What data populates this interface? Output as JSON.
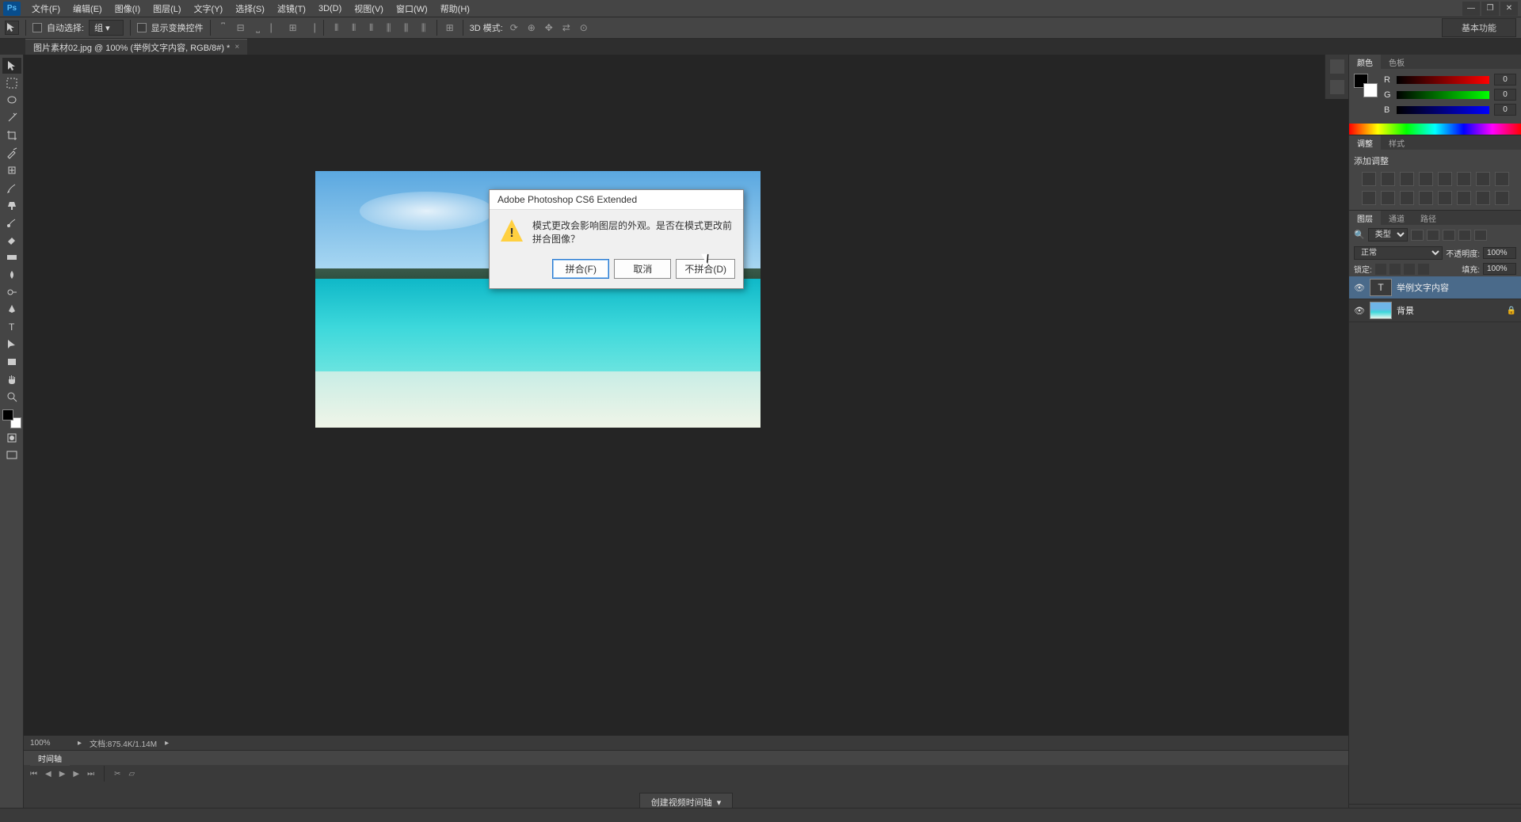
{
  "app": {
    "logo": "Ps"
  },
  "menubar": {
    "items": [
      "文件(F)",
      "编辑(E)",
      "图像(I)",
      "图层(L)",
      "文字(Y)",
      "选择(S)",
      "滤镜(T)",
      "3D(D)",
      "视图(V)",
      "窗口(W)",
      "帮助(H)"
    ]
  },
  "optionsbar": {
    "auto_select_label": "自动选择:",
    "auto_select_value": "组",
    "show_transform_label": "显示变换控件",
    "mode_3d_label": "3D 模式:",
    "basic_func": "基本功能"
  },
  "doctab": {
    "title": "图片素材02.jpg @ 100% (举例文字内容, RGB/8#) *",
    "close": "×"
  },
  "dialog": {
    "title": "Adobe Photoshop CS6 Extended",
    "message": "模式更改会影响图层的外观。是否在模式更改前拼合图像？",
    "icon_glyph": "!",
    "btn_flatten": "拼合(F)",
    "btn_cancel": "取消",
    "btn_dont_flatten": "不拼合(D)"
  },
  "statusbar": {
    "zoom": "100%",
    "doc_info": "文档:875.4K/1.14M"
  },
  "timeline": {
    "tab": "时间轴",
    "create_btn": "创建视频时间轴"
  },
  "panels": {
    "color": {
      "tab_color": "颜色",
      "tab_swatches": "色板",
      "r_label": "R",
      "r_val": "0",
      "g_label": "G",
      "g_val": "0",
      "b_label": "B",
      "b_val": "0"
    },
    "adjust": {
      "tab_adjust": "调整",
      "tab_styles": "样式",
      "label": "添加调整"
    },
    "layers": {
      "tab_layers": "图层",
      "tab_channels": "通道",
      "tab_paths": "路径",
      "filter_label": "类型",
      "blend_mode": "正常",
      "opacity_label": "不透明度:",
      "opacity_val": "100%",
      "lock_label": "锁定:",
      "fill_label": "填充:",
      "fill_val": "100%",
      "items": [
        {
          "name": "举例文字内容",
          "type": "text",
          "visible": true,
          "selected": true,
          "locked": false
        },
        {
          "name": "背景",
          "type": "image",
          "visible": true,
          "selected": false,
          "locked": true
        }
      ]
    }
  }
}
